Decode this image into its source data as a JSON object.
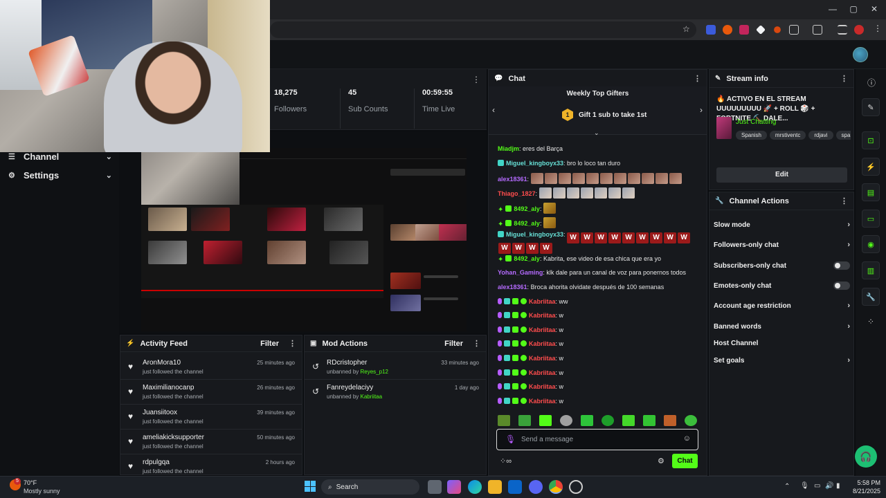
{
  "nav": {
    "channel_label": "Channel",
    "settings_label": "Settings"
  },
  "stats": [
    {
      "value": "18,275",
      "label": "Followers"
    },
    {
      "value": "45",
      "label": "Sub Counts"
    },
    {
      "value": "00:59:55",
      "label": "Time Live"
    }
  ],
  "activity": {
    "title": "Activity Feed",
    "filter": "Filter",
    "items": [
      {
        "name": "AronMora10",
        "text": "just followed the channel",
        "time": "25 minutes ago"
      },
      {
        "name": "Maximilianocanp",
        "text": "just followed the channel",
        "time": "26 minutes ago"
      },
      {
        "name": "Juansiitoox",
        "text": "just followed the channel",
        "time": "39 minutes ago"
      },
      {
        "name": "ameliakicksupporter",
        "text": "just followed the channel",
        "time": "50 minutes ago"
      },
      {
        "name": "rdpulgqa",
        "text": "just followed the channel",
        "time": "2 hours ago"
      }
    ]
  },
  "modactions": {
    "title": "Mod Actions",
    "filter": "Filter",
    "items": [
      {
        "name": "RDcristopher",
        "prefix": "unbanned by",
        "by": "Reyes_p12",
        "time": "33 minutes ago"
      },
      {
        "name": "Fanreydelaciyy",
        "prefix": "unbanned by",
        "by": "Kabriitaa",
        "time": "1 day ago"
      }
    ]
  },
  "chat": {
    "title": "Chat",
    "gifters_title": "Weekly Top Gifters",
    "gifters_rank": "1",
    "gifters_cta": "Gift 1 sub to take 1st",
    "input_placeholder": "Send a message",
    "chat_button": "Chat",
    "messages": [
      {
        "user": "Miadjm",
        "text": "eres del Barça"
      },
      {
        "user": "Miguel_kingboyx33",
        "text": "bro lo loco tan duro"
      },
      {
        "user": "alex18361",
        "text": ""
      },
      {
        "user": "Thiago_1827",
        "text": ""
      },
      {
        "user": "8492_aly",
        "text": ""
      },
      {
        "user": "8492_aly",
        "text": ""
      },
      {
        "user": "Miguel_kingboyx33",
        "text": ""
      },
      {
        "user": "8492_aly",
        "text": "Kabrita, ese video de esa chica que era yo"
      },
      {
        "user": "Yohan_Gaming",
        "text": "klk dale para un canal de voz para ponernos todos"
      },
      {
        "user": "alex18361",
        "text": "Broca ahorita olvidate después de 100 semanas"
      },
      {
        "user": "Kabriitaa",
        "text": "ww"
      },
      {
        "user": "Kabriitaa",
        "text": "w"
      },
      {
        "user": "Kabriitaa",
        "text": "w"
      },
      {
        "user": "Kabriitaa",
        "text": "w"
      },
      {
        "user": "Kabriitaa",
        "text": "w"
      },
      {
        "user": "Kabriitaa",
        "text": "w"
      },
      {
        "user": "Kabriitaa",
        "text": "w"
      },
      {
        "user": "Kabriitaa",
        "text": "w"
      }
    ]
  },
  "streaminfo": {
    "title": "Stream info",
    "stream_title": "🔥 ACTIVO EN EL STREAM UUUUUUUUU 🚀 + ROLL 🎲 + FORTNITE ⛏️ DALE...",
    "category": "Just Chatting",
    "tags": [
      "Spanish",
      "mrstiventc",
      "rdjavi",
      "spa"
    ],
    "edit": "Edit"
  },
  "channelactions": {
    "title": "Channel Actions",
    "items": [
      {
        "label": "Slow mode",
        "control": "chevron"
      },
      {
        "label": "Followers-only chat",
        "control": "chevron"
      },
      {
        "label": "Subscribers-only chat",
        "control": "toggle"
      },
      {
        "label": "Emotes-only chat",
        "control": "toggle"
      },
      {
        "label": "Account age restriction",
        "control": "chevron"
      },
      {
        "label": "Banned words",
        "control": "chevron"
      },
      {
        "label": "Host Channel",
        "control": "none"
      },
      {
        "label": "Set goals",
        "control": "chevron"
      }
    ]
  },
  "taskbar": {
    "weather_temp": "70°F",
    "weather_text": "Mostly sunny",
    "search": "Search",
    "time": "5:58 PM",
    "date": "8/21/2025",
    "notification_count": "5"
  },
  "colors": {
    "accent": "#53fc18",
    "background": "#0b0d10",
    "panel": "#17191d"
  }
}
